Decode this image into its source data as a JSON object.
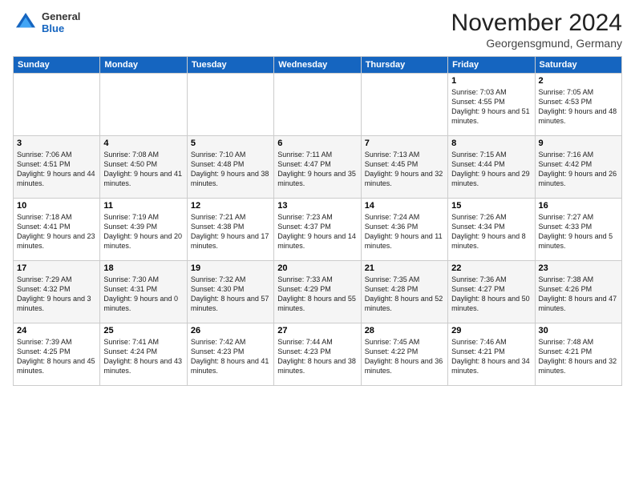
{
  "logo": {
    "line1": "General",
    "line2": "Blue"
  },
  "title": "November 2024",
  "subtitle": "Georgensgmund, Germany",
  "days_of_week": [
    "Sunday",
    "Monday",
    "Tuesday",
    "Wednesday",
    "Thursday",
    "Friday",
    "Saturday"
  ],
  "weeks": [
    [
      {
        "day": "",
        "info": ""
      },
      {
        "day": "",
        "info": ""
      },
      {
        "day": "",
        "info": ""
      },
      {
        "day": "",
        "info": ""
      },
      {
        "day": "",
        "info": ""
      },
      {
        "day": "1",
        "info": "Sunrise: 7:03 AM\nSunset: 4:55 PM\nDaylight: 9 hours and 51 minutes."
      },
      {
        "day": "2",
        "info": "Sunrise: 7:05 AM\nSunset: 4:53 PM\nDaylight: 9 hours and 48 minutes."
      }
    ],
    [
      {
        "day": "3",
        "info": "Sunrise: 7:06 AM\nSunset: 4:51 PM\nDaylight: 9 hours and 44 minutes."
      },
      {
        "day": "4",
        "info": "Sunrise: 7:08 AM\nSunset: 4:50 PM\nDaylight: 9 hours and 41 minutes."
      },
      {
        "day": "5",
        "info": "Sunrise: 7:10 AM\nSunset: 4:48 PM\nDaylight: 9 hours and 38 minutes."
      },
      {
        "day": "6",
        "info": "Sunrise: 7:11 AM\nSunset: 4:47 PM\nDaylight: 9 hours and 35 minutes."
      },
      {
        "day": "7",
        "info": "Sunrise: 7:13 AM\nSunset: 4:45 PM\nDaylight: 9 hours and 32 minutes."
      },
      {
        "day": "8",
        "info": "Sunrise: 7:15 AM\nSunset: 4:44 PM\nDaylight: 9 hours and 29 minutes."
      },
      {
        "day": "9",
        "info": "Sunrise: 7:16 AM\nSunset: 4:42 PM\nDaylight: 9 hours and 26 minutes."
      }
    ],
    [
      {
        "day": "10",
        "info": "Sunrise: 7:18 AM\nSunset: 4:41 PM\nDaylight: 9 hours and 23 minutes."
      },
      {
        "day": "11",
        "info": "Sunrise: 7:19 AM\nSunset: 4:39 PM\nDaylight: 9 hours and 20 minutes."
      },
      {
        "day": "12",
        "info": "Sunrise: 7:21 AM\nSunset: 4:38 PM\nDaylight: 9 hours and 17 minutes."
      },
      {
        "day": "13",
        "info": "Sunrise: 7:23 AM\nSunset: 4:37 PM\nDaylight: 9 hours and 14 minutes."
      },
      {
        "day": "14",
        "info": "Sunrise: 7:24 AM\nSunset: 4:36 PM\nDaylight: 9 hours and 11 minutes."
      },
      {
        "day": "15",
        "info": "Sunrise: 7:26 AM\nSunset: 4:34 PM\nDaylight: 9 hours and 8 minutes."
      },
      {
        "day": "16",
        "info": "Sunrise: 7:27 AM\nSunset: 4:33 PM\nDaylight: 9 hours and 5 minutes."
      }
    ],
    [
      {
        "day": "17",
        "info": "Sunrise: 7:29 AM\nSunset: 4:32 PM\nDaylight: 9 hours and 3 minutes."
      },
      {
        "day": "18",
        "info": "Sunrise: 7:30 AM\nSunset: 4:31 PM\nDaylight: 9 hours and 0 minutes."
      },
      {
        "day": "19",
        "info": "Sunrise: 7:32 AM\nSunset: 4:30 PM\nDaylight: 8 hours and 57 minutes."
      },
      {
        "day": "20",
        "info": "Sunrise: 7:33 AM\nSunset: 4:29 PM\nDaylight: 8 hours and 55 minutes."
      },
      {
        "day": "21",
        "info": "Sunrise: 7:35 AM\nSunset: 4:28 PM\nDaylight: 8 hours and 52 minutes."
      },
      {
        "day": "22",
        "info": "Sunrise: 7:36 AM\nSunset: 4:27 PM\nDaylight: 8 hours and 50 minutes."
      },
      {
        "day": "23",
        "info": "Sunrise: 7:38 AM\nSunset: 4:26 PM\nDaylight: 8 hours and 47 minutes."
      }
    ],
    [
      {
        "day": "24",
        "info": "Sunrise: 7:39 AM\nSunset: 4:25 PM\nDaylight: 8 hours and 45 minutes."
      },
      {
        "day": "25",
        "info": "Sunrise: 7:41 AM\nSunset: 4:24 PM\nDaylight: 8 hours and 43 minutes."
      },
      {
        "day": "26",
        "info": "Sunrise: 7:42 AM\nSunset: 4:23 PM\nDaylight: 8 hours and 41 minutes."
      },
      {
        "day": "27",
        "info": "Sunrise: 7:44 AM\nSunset: 4:23 PM\nDaylight: 8 hours and 38 minutes."
      },
      {
        "day": "28",
        "info": "Sunrise: 7:45 AM\nSunset: 4:22 PM\nDaylight: 8 hours and 36 minutes."
      },
      {
        "day": "29",
        "info": "Sunrise: 7:46 AM\nSunset: 4:21 PM\nDaylight: 8 hours and 34 minutes."
      },
      {
        "day": "30",
        "info": "Sunrise: 7:48 AM\nSunset: 4:21 PM\nDaylight: 8 hours and 32 minutes."
      }
    ]
  ]
}
